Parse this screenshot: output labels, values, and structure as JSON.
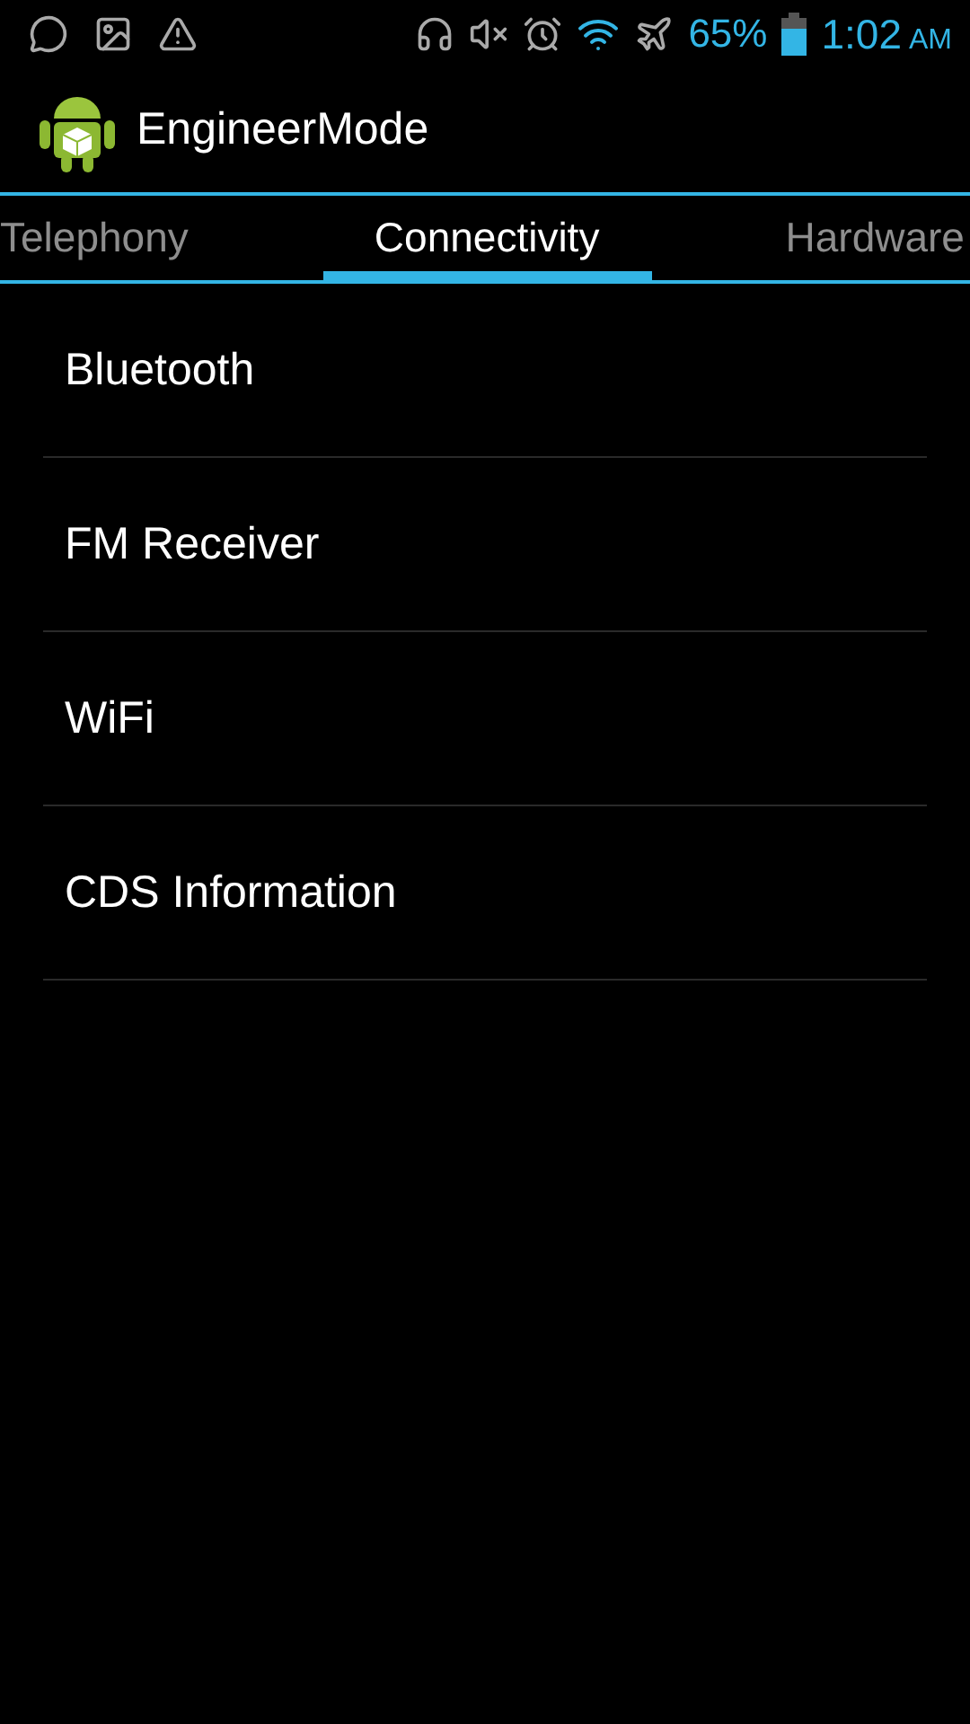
{
  "status_bar": {
    "battery": "65%",
    "time": "1:02",
    "meridiem": "AM"
  },
  "action_bar": {
    "title": "EngineerMode"
  },
  "tabs": [
    {
      "label": "Telephony",
      "selected": false
    },
    {
      "label": "Connectivity",
      "selected": true
    },
    {
      "label": "Hardware",
      "selected": false
    }
  ],
  "items": [
    {
      "label": "Bluetooth"
    },
    {
      "label": "FM Receiver"
    },
    {
      "label": "WiFi"
    },
    {
      "label": "CDS Information"
    }
  ]
}
